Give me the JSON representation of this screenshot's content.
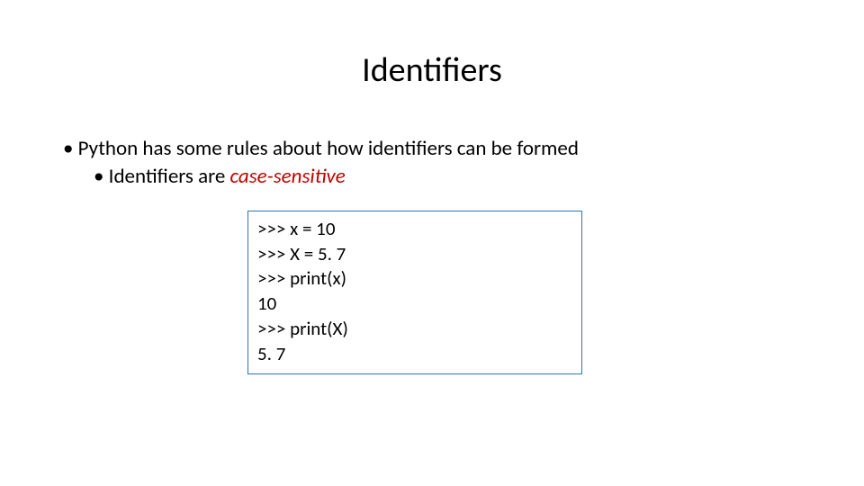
{
  "title": "Identifiers",
  "bullets": {
    "lvl1_0": "Python has some rules about how identifiers can be formed",
    "lvl2_0_prefix": "Identifiers are ",
    "lvl2_0_emph": "case-sensitive"
  },
  "code": {
    "l1": ">>> x = 10",
    "l2": ">>> X = 5. 7",
    "l3": ">>> print(x)",
    "l4": "10",
    "l5": ">>> print(X)",
    "l6": "5. 7"
  }
}
